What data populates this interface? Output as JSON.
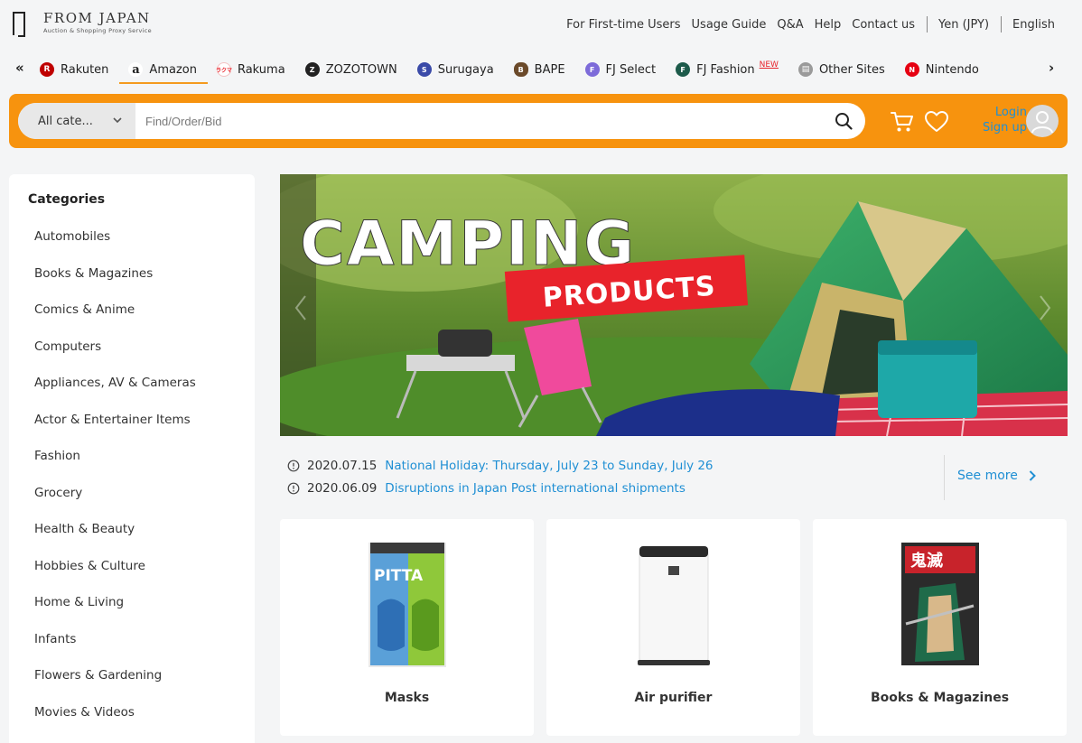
{
  "brand": {
    "title": "FROM JAPAN",
    "tagline": "Auction & Shopping Proxy Service"
  },
  "top_links": [
    "For First-time Users",
    "Usage Guide",
    "Q&A",
    "Help",
    "Contact us"
  ],
  "currency": "Yen (JPY)",
  "language": "English",
  "sites": [
    {
      "label": "Rakuten",
      "icon": "rakuten-icon",
      "color": "#bf0000"
    },
    {
      "label": "Amazon",
      "icon": "amazon-icon",
      "color": "#ffffff"
    },
    {
      "label": "Rakuma",
      "icon": "rakuma-icon",
      "color": "#e8232b"
    },
    {
      "label": "ZOZOTOWN",
      "icon": "zozotown-icon",
      "color": "#222222"
    },
    {
      "label": "Surugaya",
      "icon": "surugaya-icon",
      "color": "#3a4aa8"
    },
    {
      "label": "BAPE",
      "icon": "bape-icon",
      "color": "#6b4a2a"
    },
    {
      "label": "FJ Select",
      "icon": "fj-select-icon",
      "color": "#7d6bd9"
    },
    {
      "label": "FJ Fashion",
      "icon": "fj-fashion-icon",
      "color": "#1c5a4a"
    },
    {
      "label": "Other Sites",
      "icon": "other-sites-icon",
      "color": "#9a9a9a"
    },
    {
      "label": "Nintendo",
      "icon": "nintendo-icon",
      "color": "#e60012"
    }
  ],
  "new_badge": "NEW",
  "search": {
    "category": "All cate...",
    "placeholder": "Find/Order/Bid"
  },
  "auth": {
    "login": "Login",
    "signup": "Sign up"
  },
  "sidebar": {
    "title": "Categories",
    "items": [
      "Automobiles",
      "Books & Magazines",
      "Comics & Anime",
      "Computers",
      "Appliances, AV & Cameras",
      "Actor & Entertainer Items",
      "Fashion",
      "Grocery",
      "Health & Beauty",
      "Hobbies & Culture",
      "Home & Living",
      "Infants",
      "Flowers & Gardening",
      "Movies & Videos"
    ]
  },
  "banner": {
    "headline": "CAMPING",
    "subheadline": "PRODUCTS"
  },
  "news": [
    {
      "date": "2020.07.15",
      "headline": "National Holiday: Thursday, July 23 to Sunday, July 26"
    },
    {
      "date": "2020.06.09",
      "headline": "Disruptions in Japan Post international shipments"
    }
  ],
  "see_more": "See more",
  "products": [
    {
      "label": "Masks"
    },
    {
      "label": "Air purifier"
    },
    {
      "label": "Books & Magazines"
    }
  ],
  "colors": {
    "accent": "#f7930e",
    "link": "#1f8fd4",
    "underline": "#f49a1e",
    "new": "#e8232b"
  }
}
